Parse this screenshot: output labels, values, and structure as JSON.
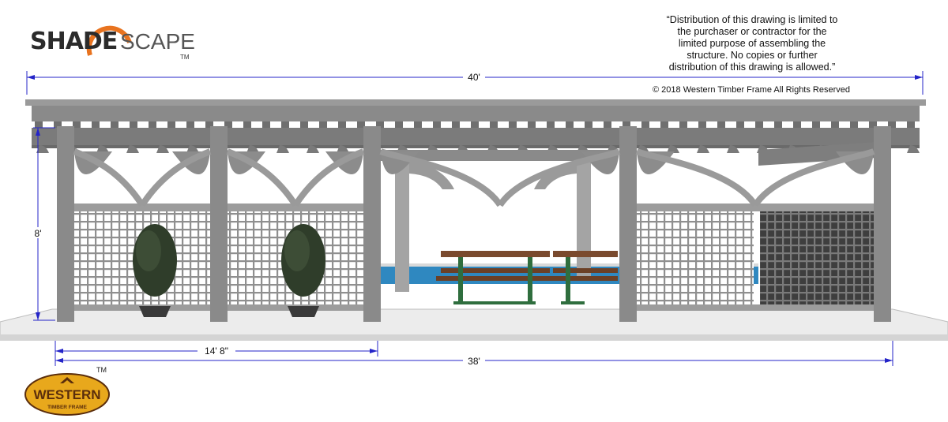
{
  "brand": {
    "logo_part1": "SHADE",
    "logo_part2": "SCAPE",
    "logo_tm": "TM",
    "maker_logo_word": "WESTERN",
    "maker_logo_sub": "TIMBER FRAME",
    "maker_tm": "TM"
  },
  "notice": {
    "lines": [
      "“Distribution of this drawing is limited to",
      "the purchaser or contractor for the",
      "limited purpose of assembling the",
      "structure. No copies or further",
      "distribution of this drawing is allowed.”"
    ],
    "copyright": "© 2018 Western Timber Frame All Rights Reserved"
  },
  "dimensions": {
    "overall_width": "40'",
    "height": "8'",
    "bay_width": "14' 8\"",
    "post_span": "38'"
  },
  "colors": {
    "dimension_line": "#2424c8",
    "timber": "#8a8a8a",
    "timber_dark": "#6e6e6e",
    "lattice": "#9a9a9a",
    "slab": "#ededed",
    "pool": "#2f88c0",
    "tabletop": "#7a4a2e",
    "bench_frame": "#2f6e3e",
    "logo_orange": "#e8731f",
    "maker_gold": "#e8a81c",
    "maker_brown": "#5a2d0c"
  }
}
